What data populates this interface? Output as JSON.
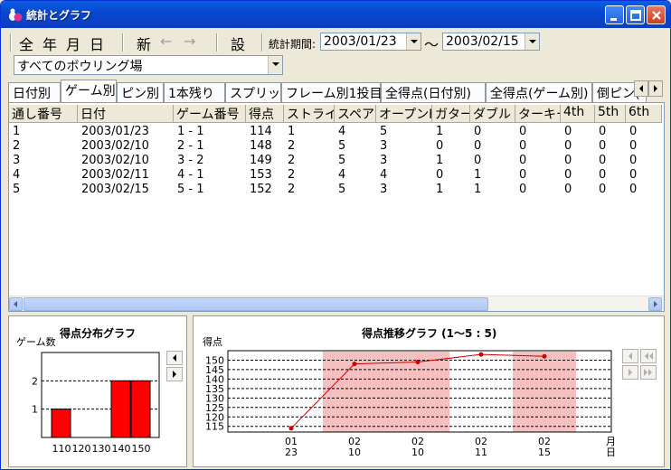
{
  "window": {
    "title": "統計とグラフ"
  },
  "toolbar": {
    "all": "全",
    "year": "年",
    "month": "月",
    "day": "日",
    "new": "新",
    "back": "←",
    "forward": "→",
    "settings": "設",
    "period_label": "統計期間:",
    "start_date": "2003/01/23",
    "tilde": "～",
    "end_date": "2003/02/15"
  },
  "location": {
    "selected": "すべてのボウリング場"
  },
  "tabs": [
    {
      "label": "日付別"
    },
    {
      "label": "ゲーム別"
    },
    {
      "label": "ピン別"
    },
    {
      "label": "1本残り"
    },
    {
      "label": "スプリット"
    },
    {
      "label": "フレーム別1投目"
    },
    {
      "label": "全得点(日付別)"
    },
    {
      "label": "全得点(ゲーム別)"
    },
    {
      "label": "倒ピン("
    }
  ],
  "table": {
    "columns": [
      "通し番号",
      "日付",
      "ゲーム番号",
      "得点",
      "ストライク",
      "スペア",
      "オープンF",
      "ガター",
      "ダブル",
      "ターキー",
      "4th",
      "5th",
      "6th"
    ],
    "rows": [
      [
        "1",
        "2003/01/23",
        "1 - 1",
        "114",
        "1",
        "4",
        "5",
        "1",
        "0",
        "0",
        "0",
        "0",
        "0"
      ],
      [
        "2",
        "2003/02/10",
        "2 - 1",
        "148",
        "2",
        "5",
        "3",
        "0",
        "0",
        "0",
        "0",
        "0",
        "0"
      ],
      [
        "3",
        "2003/02/10",
        "3 - 2",
        "149",
        "2",
        "5",
        "3",
        "1",
        "0",
        "0",
        "0",
        "0",
        "0"
      ],
      [
        "4",
        "2003/02/11",
        "4 - 1",
        "153",
        "2",
        "4",
        "4",
        "0",
        "1",
        "0",
        "0",
        "0",
        "0"
      ],
      [
        "5",
        "2003/02/15",
        "5 - 1",
        "152",
        "2",
        "5",
        "3",
        "1",
        "1",
        "0",
        "0",
        "0",
        "0"
      ]
    ]
  },
  "chart_data": [
    {
      "type": "bar",
      "title": "得点分布グラフ",
      "ylabel": "ゲーム数",
      "xlabel": "得点",
      "categories": [
        "110",
        "120",
        "130",
        "140",
        "150"
      ],
      "values": [
        1,
        0,
        0,
        2,
        2
      ],
      "yticks": [
        "1",
        "2"
      ],
      "ylim": [
        0,
        3
      ],
      "bar_color": "#ff0000"
    },
    {
      "type": "line",
      "title": "得点推移グラフ (1～5 : 5)",
      "ylabel": "得点",
      "xlabel_month": "月",
      "xlabel_day": "日",
      "x": [
        {
          "month": "01",
          "day": "23"
        },
        {
          "month": "02",
          "day": "10"
        },
        {
          "month": "02",
          "day": "10"
        },
        {
          "month": "02",
          "day": "11"
        },
        {
          "month": "02",
          "day": "15"
        }
      ],
      "values": [
        114,
        148,
        149,
        153,
        152
      ],
      "yticks": [
        "115",
        "120",
        "125",
        "130",
        "135",
        "140",
        "145",
        "150"
      ],
      "ylim": [
        112,
        155
      ],
      "line_color": "#cc0000",
      "band_color": "#f6c0c0"
    }
  ]
}
